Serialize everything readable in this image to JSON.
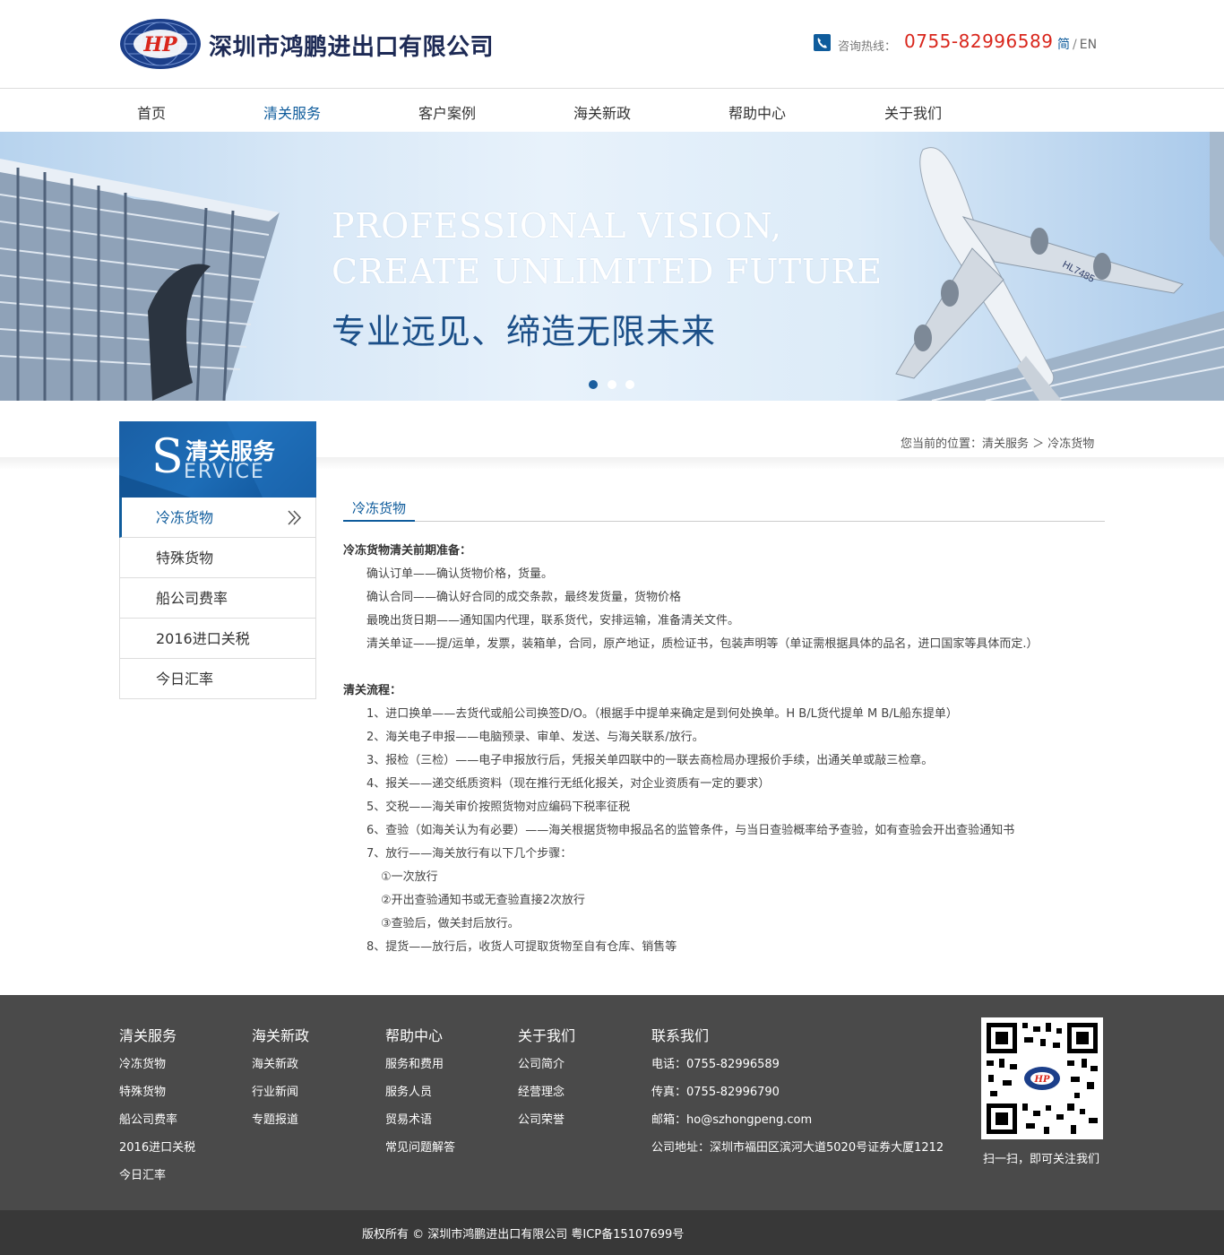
{
  "header": {
    "company_name": "深圳市鸿鹏进出口有限公司",
    "logo_letters": "HP",
    "hotline_label": "咨询热线：",
    "hotline_number": "0755-82996589",
    "lang_cn": "简",
    "lang_sep": "/",
    "lang_en": "EN"
  },
  "nav": {
    "items": [
      {
        "label": "首页"
      },
      {
        "label": "清关服务",
        "active": true
      },
      {
        "label": "客户案例"
      },
      {
        "label": "海关新政"
      },
      {
        "label": "帮助中心"
      },
      {
        "label": "关于我们"
      }
    ]
  },
  "banner": {
    "en_line1": "PROFESSIONAL VISION,",
    "en_line2": "CREATE UNLIMITED FUTURE",
    "cn": "专业远见、缔造无限未来",
    "plane_reg": "HL7485",
    "slide_count": 3,
    "active_slide": 1
  },
  "sidebar": {
    "header_cn": "清关服务",
    "header_s": "S",
    "header_en": "ERVICE",
    "items": [
      {
        "label": "冷冻货物",
        "active": true
      },
      {
        "label": "特殊货物"
      },
      {
        "label": "船公司费率"
      },
      {
        "label": "2016进口关税"
      },
      {
        "label": "今日汇率"
      }
    ]
  },
  "breadcrumb": {
    "text": "您当前的位置：清关服务 ＞ 冷冻货物"
  },
  "article": {
    "title": "冷冻货物",
    "section1_heading": "冷冻货物清关前期准备：",
    "section1_lines": [
      "确认订单——确认货物价格，货量。",
      "确认合同——确认好合同的成交条款，最终发货量，货物价格",
      "最晚出货日期——通知国内代理，联系货代，安排运输，准备清关文件。",
      "清关单证——提/运单，发票，装箱单，合同，原产地证，质检证书，包装声明等（单证需根据具体的品名，进口国家等具体而定.）"
    ],
    "section2_heading": "清关流程：",
    "section2_lines": [
      "1、进口换单——去货代或船公司换签D/O。（根据手中提单来确定是到何处换单。H B/L货代提单 M B/L船东提单）",
      "2、海关电子申报——电脑预录、审单、发送、与海关联系/放行。",
      "3、报检（三检）——电子申报放行后，凭报关单四联中的一联去商检局办理报价手续，出通关单或敲三检章。",
      "4、报关——递交纸质资料（现在推行无纸化报关，对企业资质有一定的要求）",
      "5、交税——海关审价按照货物对应编码下税率征税",
      "6、查验（如海关认为有必要）——海关根据货物申报品名的监管条件，与当日查验概率给予查验，如有查验会开出查验通知书",
      "7、放行——海关放行有以下几个步骤："
    ],
    "sub_steps": [
      "①一次放行",
      "②开出查验通知书或无查验直接2次放行",
      "③查验后，做关封后放行。"
    ],
    "last_line": "8、提货——放行后，收货人可提取货物至自有仓库、销售等"
  },
  "footer": {
    "columns": [
      {
        "title": "清关服务",
        "items": [
          "冷冻货物",
          "特殊货物",
          "船公司费率",
          "2016进口关税",
          "今日汇率"
        ]
      },
      {
        "title": "海关新政",
        "items": [
          "海关新政",
          "行业新闻",
          "专题报道"
        ]
      },
      {
        "title": "帮助中心",
        "items": [
          "服务和费用",
          "服务人员",
          "贸易术语",
          "常见问题解答"
        ]
      },
      {
        "title": "关于我们",
        "items": [
          "公司简介",
          "经营理念",
          "公司荣誉"
        ]
      },
      {
        "title": "联系我们",
        "items": [
          "电话：0755-82996589",
          "传真：0755-82996790",
          "邮箱：ho@szhongpeng.com",
          "公司地址：深圳市福田区滨河大道5020号证券大厦1212"
        ]
      }
    ],
    "qr_caption": "扫一扫，即可关注我们",
    "copyright": "版权所有 © 深圳市鸿鹏进出口有限公司 粤ICP备15107699号"
  },
  "colors": {
    "brand_blue": "#0f5c9c",
    "hotline_red": "#d9261c",
    "footer_bg": "#4a4a4a",
    "copyright_bg": "#383838"
  }
}
